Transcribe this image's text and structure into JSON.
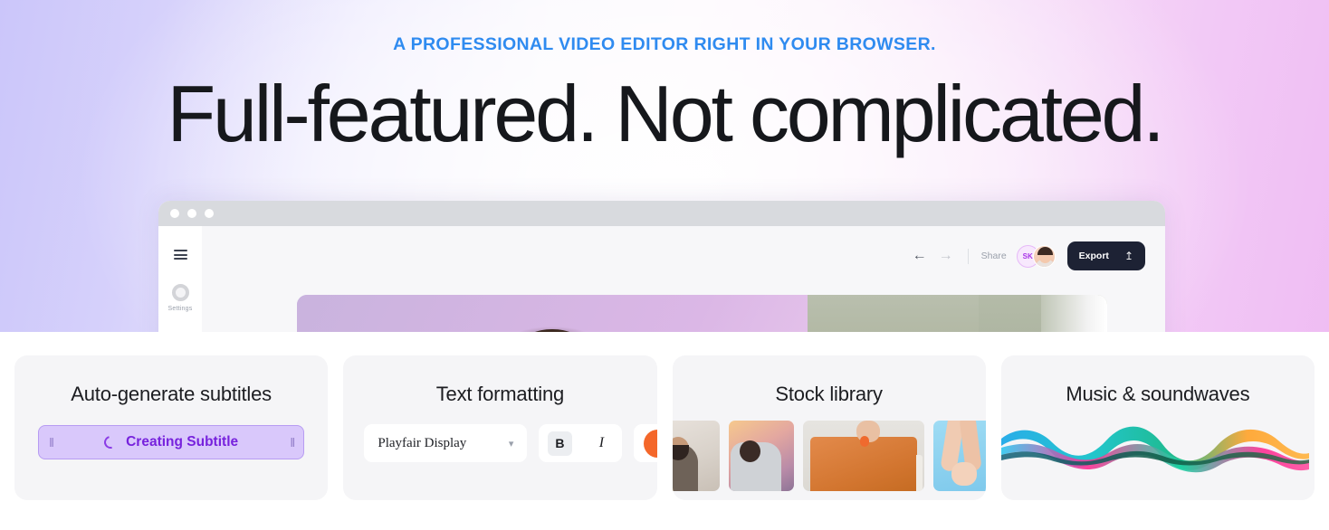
{
  "hero": {
    "eyebrow": "A PROFESSIONAL VIDEO EDITOR RIGHT IN YOUR BROWSER.",
    "headline": "Full-featured. Not complicated.",
    "eyebrow_color": "#2f8bf0",
    "headline_color": "#16181c",
    "background_gradient_from": "#cbc6fa",
    "background_gradient_to": "#efbdf3"
  },
  "browser": {
    "traffic_lights": [
      "dot-1",
      "dot-2",
      "dot-3"
    ],
    "sidebar": {
      "menu_icon": "hamburger-icon",
      "settings_icon": "gear-icon",
      "settings_label": "Settings"
    },
    "toolbar": {
      "undo_icon": "undo-arrow-icon",
      "redo_icon": "redo-arrow-icon",
      "share_label": "Share",
      "avatar_initials": "SK",
      "avatar_photo": "user-photo-avatar",
      "export_label": "Export",
      "export_icon": "upload-icon",
      "export_bg": "#1d2234"
    },
    "canvas": {
      "selection_color": "#4cc3f5",
      "handles": [
        "top-left",
        "top-right",
        "bottom-center"
      ]
    }
  },
  "cards": [
    {
      "title": "Auto-generate subtitles",
      "progress": {
        "label": "Creating Subtitle",
        "left_grip": "‖",
        "right_grip": "‖",
        "spinner": "loading-spinner-icon",
        "fill_color": "#d9c8fb",
        "border_color": "#b79cf2",
        "text_color": "#7722dd"
      }
    },
    {
      "title": "Text formatting",
      "font_name": "Playfair Display",
      "chevron": "⌄",
      "bold_label": "B",
      "italic_label": "I",
      "color_swatch": "#f4672a"
    },
    {
      "title": "Stock library",
      "thumbnails": [
        "thumb-people-meeting",
        "thumb-woman-selfie",
        "thumb-orange-notebook",
        "thumb-hands-blue"
      ]
    },
    {
      "title": "Music & soundwaves",
      "wave_colors": [
        "#2fb4e8",
        "#1fc7a8",
        "#ff2e93",
        "#ffa632",
        "#12b3c4",
        "#0f5f6b"
      ]
    }
  ]
}
